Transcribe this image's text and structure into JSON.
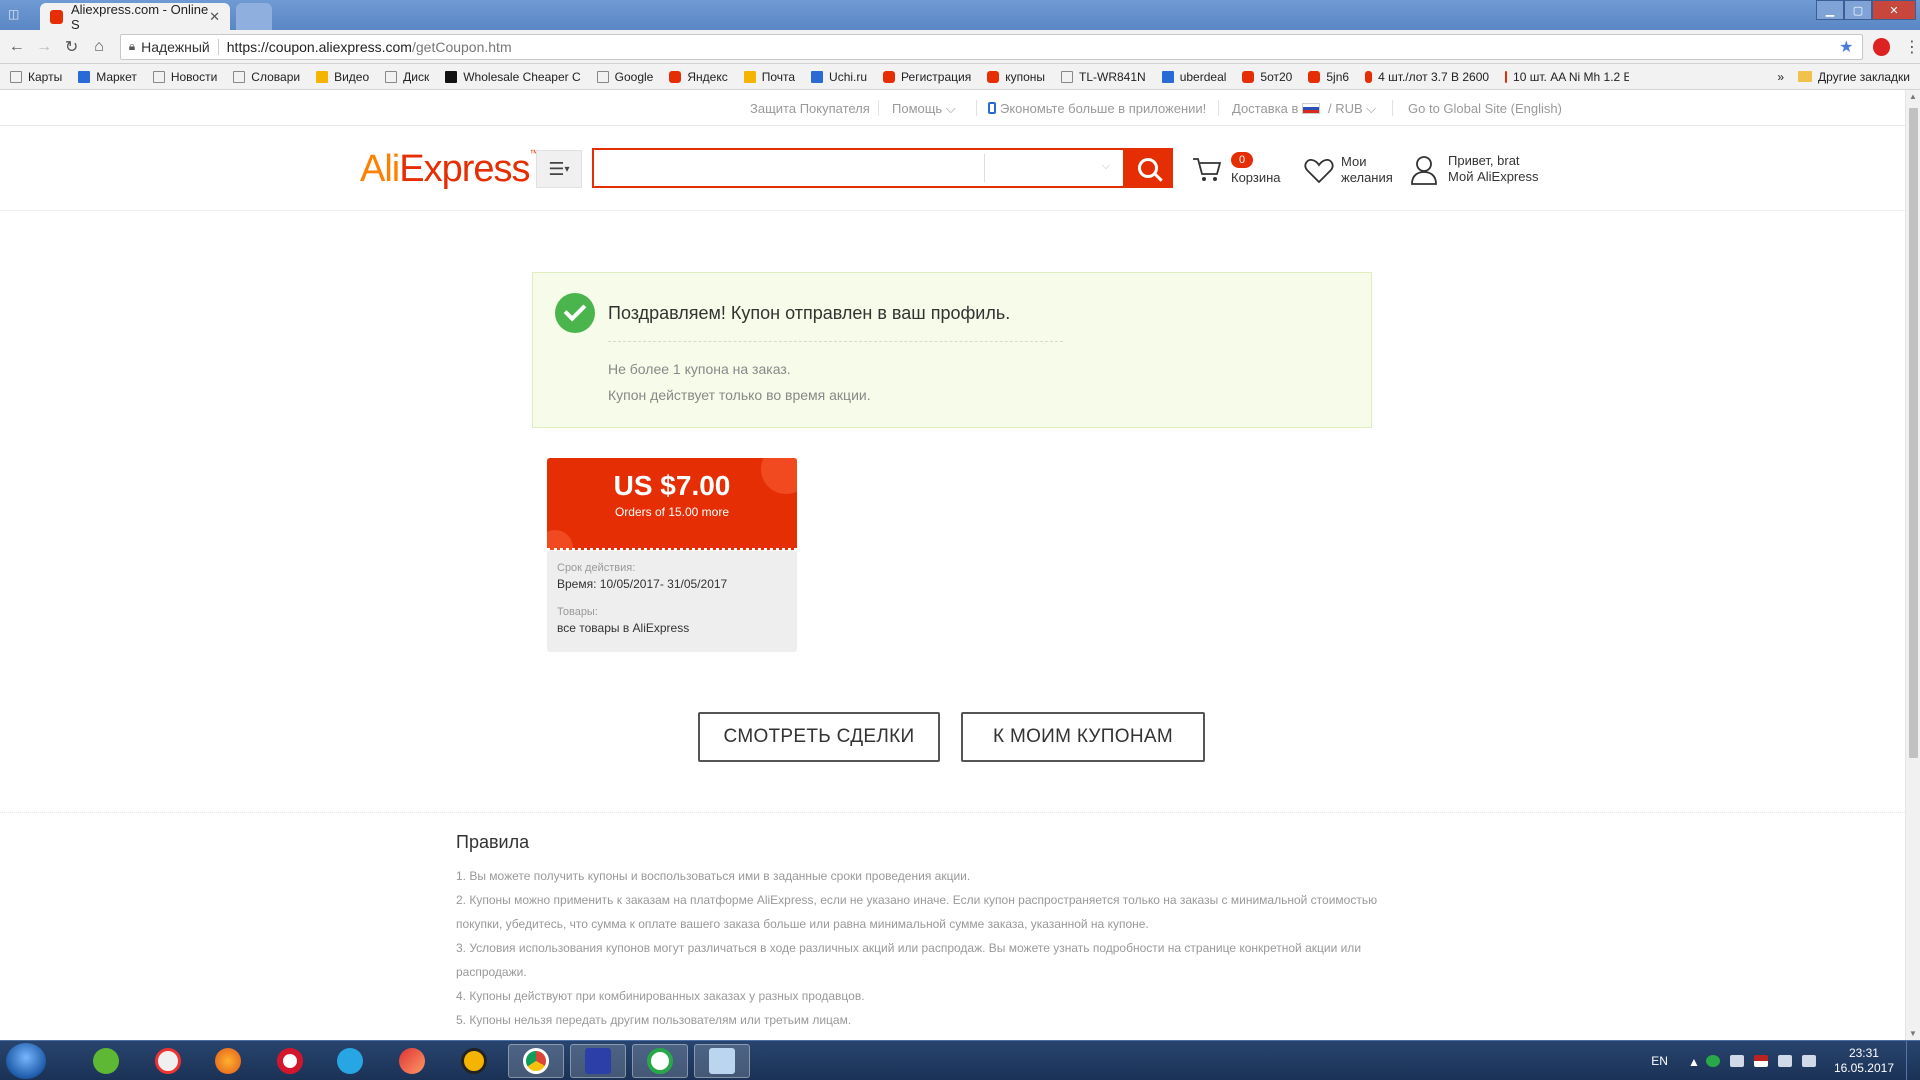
{
  "browser": {
    "tab_title": "Aliexpress.com - Online S",
    "tab_close": "✕",
    "secure_label": "Надежный",
    "url_host": "https://coupon.aliexpress.com",
    "url_path": "/getCoupon.htm",
    "bookmarks": [
      "Карты",
      "Маркет",
      "Новости",
      "Словари",
      "Видео",
      "Диск",
      "Wholesale Cheaper C",
      "Google",
      "Яндекс",
      "Почта",
      "Uchi.ru",
      "Регистрация",
      "купоны",
      "TL-WR841N",
      "uberdeal",
      "5от20",
      "5jn6",
      "4 шт./лот 3.7 В 2600",
      "10 шт. AA Ni Mh 1.2 E"
    ],
    "bookmarks_more": "»",
    "other_bookmarks": "Другие закладки"
  },
  "toplinks": {
    "buyer_protection": "Защита Покупателя",
    "help": "Помощь",
    "app": "Экономьте больше в приложении!",
    "delivery": "Доставка в",
    "currency": "RUB",
    "global": "Go to Global Site (English)"
  },
  "header": {
    "logo_a": "Ali",
    "logo_e": "Express",
    "logo_tm": "™",
    "cart_count": "0",
    "cart_label": "Корзина",
    "wish_line1": "Мои",
    "wish_line2": "желания",
    "user_line1": "Привет, brat",
    "user_line2": "Мой AliExpress"
  },
  "success": {
    "title": "Поздравляем! Купон отправлен в ваш профиль.",
    "note1": "Не более 1 купона на заказ.",
    "note2": "Купон действует только во время акции."
  },
  "coupon": {
    "amount": "US $7.00",
    "condition": "Orders of 15.00 more",
    "validity_label": "Срок действия:",
    "validity_value": "Время: 10/05/2017- 31/05/2017",
    "goods_label": "Товары:",
    "goods_value": "все товары в AliExpress"
  },
  "buttons": {
    "deals": "СМОТРЕТЬ СДЕЛКИ",
    "my_coupons": "К МОИМ КУПОНАМ"
  },
  "rules": {
    "title": "Правила",
    "items": [
      "1. Вы можете получить купоны и воспользоваться ими в заданные сроки проведения акции.",
      "2. Купоны можно применить к заказам на платформе AliExpress, если не указано иначе. Если купон распространяется только на заказы с минимальной стоимостью покупки, убедитесь, что сумма к оплате вашего заказа больше или равна минимальной сумме заказа, указанной на купоне.",
      "3. Условия использования купонов могут различаться в ходе различных акций или распродаж. Вы можете узнать подробности на странице конкретной акции или распродажи.",
      "4. Купоны действуют при комбинированных заказах у разных продавцов.",
      "5. Купоны нельзя передать другим пользователям или третьим лицам."
    ]
  },
  "taskbar": {
    "lang": "EN",
    "time": "23:31",
    "date": "16.05.2017"
  },
  "colors": {
    "brand_red": "#e62e04",
    "brand_orange": "#ff7f00",
    "success_green": "#4ab54d"
  }
}
